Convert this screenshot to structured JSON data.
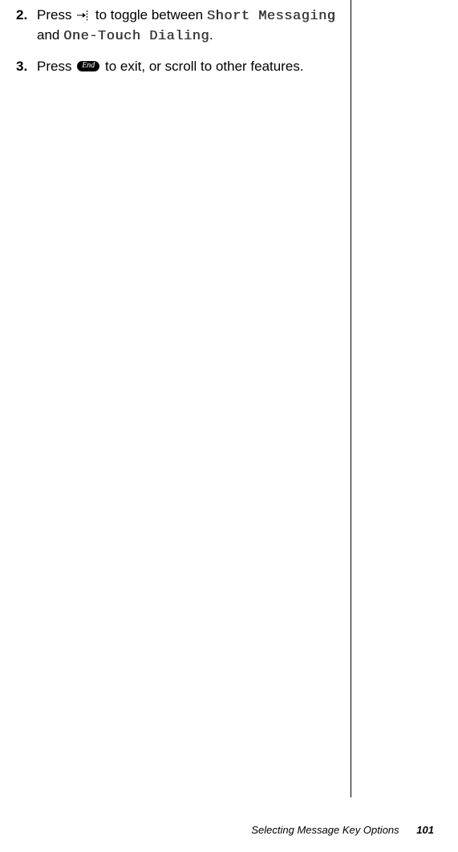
{
  "steps": [
    {
      "num": "2.",
      "text_before_icon": "Press ",
      "icon": "joystick",
      "text_after_icon": " to toggle between ",
      "ocr1": "Short Messaging",
      "mid_text": " and ",
      "ocr2": "One-Touch Dialing",
      "end_text": "."
    },
    {
      "num": "3.",
      "text_before_icon": "Press ",
      "icon": "end",
      "icon_label": "End",
      "text_after_icon": " to exit, or scroll to other features."
    }
  ],
  "footer": {
    "section": "Selecting Message Key Options",
    "page": "101"
  }
}
